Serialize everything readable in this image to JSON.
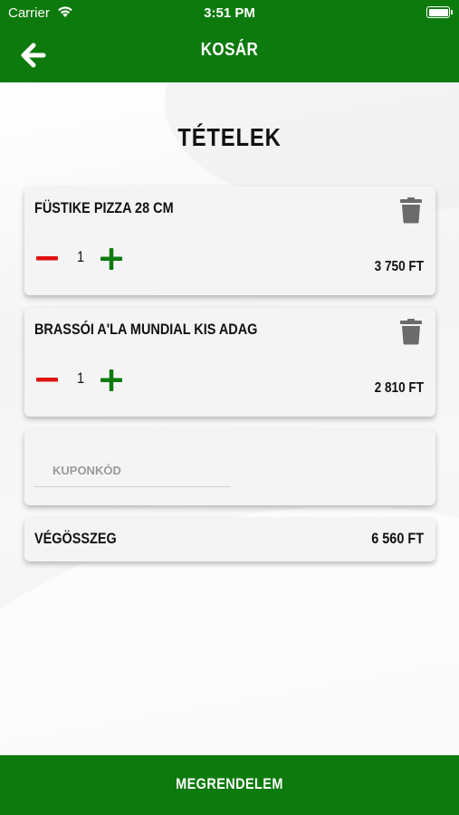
{
  "status_bar": {
    "carrier": "Carrier",
    "time": "3:51 PM"
  },
  "header": {
    "title": "KOSÁR",
    "back_icon": "arrow-left-icon"
  },
  "items_heading": "TÉTELEK",
  "cart_items": [
    {
      "name": "FÜSTIKE PIZZA 28 CM",
      "quantity": "1",
      "price": "3 750 FT"
    },
    {
      "name": "BRASSÓI A'LA MUNDIAL KIS ADAG",
      "quantity": "1",
      "price": "2 810 FT"
    }
  ],
  "coupon": {
    "placeholder": "KUPONKÓD",
    "value": ""
  },
  "total": {
    "label": "VÉGÖSSZEG",
    "value": "6 560 FT"
  },
  "order_button": {
    "label": "MEGRENDELEM"
  },
  "colors": {
    "brand_green": "#0d7a0d",
    "minus_red": "#e01010",
    "trash_gray": "#6b6b6b"
  }
}
